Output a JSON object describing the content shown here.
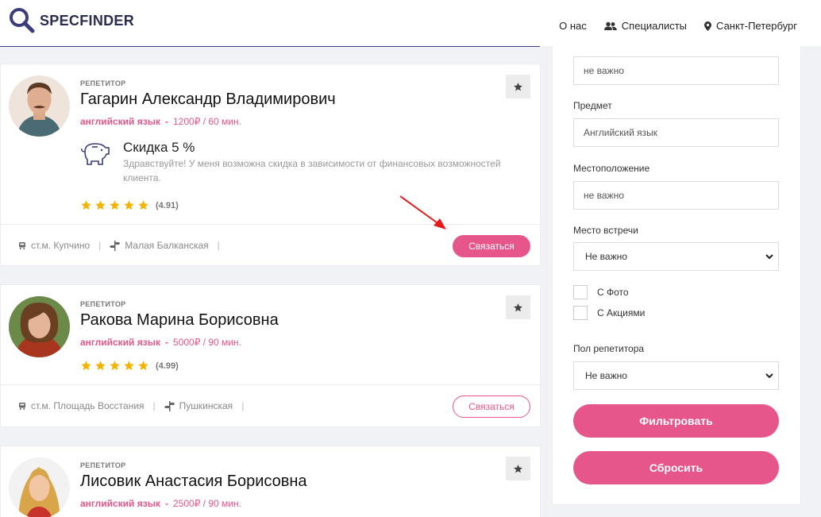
{
  "header": {
    "logo_text": "SPECFINDER",
    "nav": [
      {
        "label": "О нас",
        "icon": ""
      },
      {
        "label": "Специалисты",
        "icon": "users-icon"
      },
      {
        "label": "Санкт-Петербург",
        "icon": "map-pin-icon"
      }
    ]
  },
  "cards": [
    {
      "role": "репетитор",
      "name": "Гагарин Александр Владимирович",
      "subject": "английский язык",
      "price": "1200₽ / 60 мин.",
      "promo_title": "Скидка 5 %",
      "promo_text": "Здравствуйте! У меня возможна скидка в зависимости от финансовых возможностей клиента.",
      "stars": 5,
      "rating": "(4.91)",
      "metro": "ст.м. Купчино",
      "street": "Малая Балканская",
      "contact_label": "Связаться"
    },
    {
      "role": "репетитор",
      "name": "Ракова Марина Борисовна",
      "subject": "английский язык",
      "price": "5000₽ / 90 мин.",
      "stars": 5,
      "rating": "(4.99)",
      "metro": "ст.м. Площадь Восстания",
      "street": "Пушкинская",
      "contact_label": "Связаться"
    },
    {
      "role": "репетитор",
      "name": "Лисовик Анастасия Борисовна",
      "subject": "английский язык",
      "price": "2500₽ / 90 мин."
    }
  ],
  "filters": {
    "top_value": "не важно",
    "subject_label": "Предмет",
    "subject_value": "Английский язык",
    "location_label": "Местоположение",
    "location_value": "не важно",
    "meeting_label": "Место встречи",
    "meeting_value": "Не важно",
    "photo_label": "С Фото",
    "promo_label": "С Акциями",
    "gender_label": "Пол репетитора",
    "gender_value": "Не важно",
    "filter_button": "Фильтровать",
    "reset_button": "Сбросить"
  },
  "colors": {
    "accent": "#e7568a",
    "brand": "#3b3d7a",
    "star": "#f5b301"
  }
}
